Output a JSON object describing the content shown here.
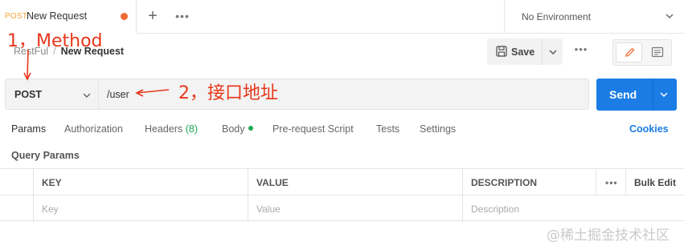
{
  "tab": {
    "method": "POST",
    "name": "New Request"
  },
  "tabbar": {
    "add_symbol": "+",
    "more_symbol": "•••"
  },
  "environment": {
    "label": "No Environment"
  },
  "breadcrumb": {
    "parent": "RestFul",
    "separator": "/",
    "current": "New Request"
  },
  "toolbar": {
    "save_label": "Save",
    "more_symbol": "•••"
  },
  "request": {
    "method": "POST",
    "url": "/user",
    "send_label": "Send"
  },
  "subtabs": {
    "params": "Params",
    "authorization": "Authorization",
    "headers": "Headers",
    "headers_count": "(8)",
    "body": "Body",
    "prerequest": "Pre-request Script",
    "tests": "Tests",
    "settings": "Settings",
    "cookies": "Cookies"
  },
  "query_params": {
    "title": "Query Params",
    "columns": {
      "key": "KEY",
      "value": "VALUE",
      "description": "DESCRIPTION",
      "more": "•••",
      "bulk_edit": "Bulk Edit"
    },
    "placeholders": {
      "key": "Key",
      "value": "Value",
      "description": "Description"
    }
  },
  "annotations": {
    "method": "1，Method",
    "api": "2，接口地址"
  },
  "watermark": "@稀土掘金技术社区",
  "colors": {
    "accent": "#1b7ce5",
    "method_tab": "#f2a33a",
    "annotation": "#e8361b",
    "success": "#1ea454",
    "unsaved_dot": "#ef6c33"
  },
  "icons": [
    "unsaved-dot-icon",
    "plus-icon",
    "more-icon",
    "chevron-down-icon",
    "save-icon",
    "pencil-icon",
    "document-icon"
  ]
}
